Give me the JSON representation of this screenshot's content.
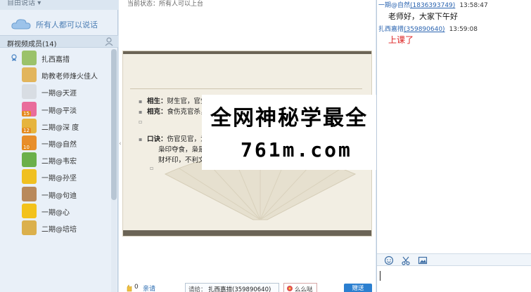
{
  "left_panel": {
    "free_talk": "自由说话",
    "everyone_speak": "所有人都可以说话",
    "members_title": "群视频成员(14)",
    "members": [
      {
        "name": "扎西嘉措",
        "avatar_color": "#9bc26a",
        "level": "",
        "speaking": true
      },
      {
        "name": "助教老师烽火佳人",
        "avatar_color": "#e2b55c",
        "level": "",
        "speaking": false
      },
      {
        "name": "一期@天涯",
        "avatar_color": "#d8dde3",
        "level": "",
        "speaking": false
      },
      {
        "name": "一期@平淡",
        "avatar_color": "#e96c9b",
        "level": "15",
        "speaking": false
      },
      {
        "name": "二期@深 度",
        "avatar_color": "#e6b43d",
        "level": "12",
        "speaking": false
      },
      {
        "name": "一期@自然",
        "avatar_color": "#e88e2a",
        "level": "10",
        "speaking": false
      },
      {
        "name": "二期@韦宏",
        "avatar_color": "#6bb04a",
        "level": "",
        "speaking": false
      },
      {
        "name": "一期@孙坚",
        "avatar_color": "#f0c020",
        "level": "",
        "speaking": false
      },
      {
        "name": "一期@句迪",
        "avatar_color": "#b9895b",
        "level": "",
        "speaking": false
      },
      {
        "name": "一期@心",
        "avatar_color": "#f3c21b",
        "level": "",
        "speaking": false
      },
      {
        "name": "二期@培培",
        "avatar_color": "#dbb04c",
        "level": "",
        "speaking": false
      }
    ]
  },
  "center_panel": {
    "status": "当前状态：所有人可以上台",
    "slide": {
      "line1_label": "相生：",
      "line1_text": "财生官，官生印，印生身，比劫生食伤，食伤生财",
      "line2_label": "相克：",
      "line2_text": "食伤克官杀，官杀克比劫，比劫克财，财克印枭，",
      "line3_label": "口诀：",
      "line3_text": "伤官见官，为祸百端。（伤官和官的力量相当时，",
      "line4_text": "枭印夺食，枭是老攒，见到小鸡就捉，遇之为凶克信息",
      "line5_text": "财坏印，不利文凭，也有因取财而不顾名声之意，因财"
    },
    "watermark_line1": "全网神秘学最全",
    "watermark_line2": "761m.com",
    "applause_count": "0",
    "applause_label": "亲请",
    "speaker_label": "请给：",
    "speaker_value": "扎西嘉措(359890640)",
    "flower_label": "么么哒",
    "send_label": "赠送"
  },
  "right_panel": {
    "messages": [
      {
        "user": "一期@自然",
        "id": "(1836393749)",
        "time": "13:58:47",
        "text": "老师好，大家下午好",
        "red": false
      },
      {
        "user": "扎西嘉措",
        "id": "(359890640)",
        "time": "13:59:08",
        "text": "上课了",
        "red": true
      }
    ]
  },
  "colors": {
    "accent": "#2b7fd0",
    "panel_bg": "#e9f0f8",
    "red_text": "#dd2222"
  }
}
